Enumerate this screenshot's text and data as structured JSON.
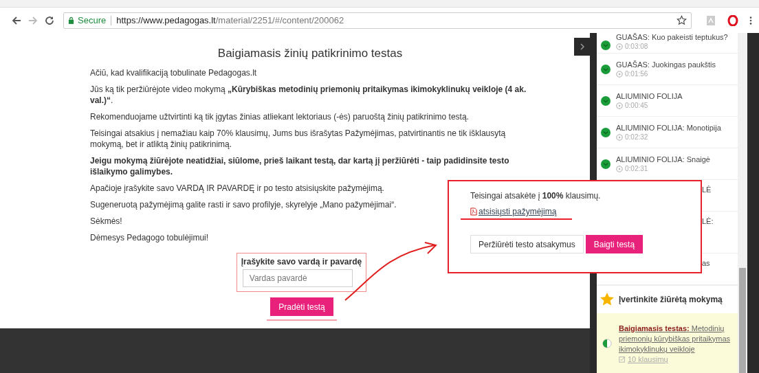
{
  "browser": {
    "secure_label": "Secure",
    "url_host": "https://www.pedagogas.lt",
    "url_path": "/material/2251/#/content/200062"
  },
  "content": {
    "title": "Baigiamasis žinių patikrinimo testas",
    "paragraphs": [
      {
        "text": "Ačiū, kad kvalifikaciją tobulinate Pedagogas.lt",
        "bold": false
      },
      {
        "text": "Jūs ką tik peržiūrėjote video mokymą **„Kūrybiškas metodinių priemonių pritaikymas ikimokyklinukų veikloje (4 ak. val.)“**.",
        "bold": false
      },
      {
        "text": "Rekomenduojame užtvirtinti ką tik įgytas žinias atliekant lektoriaus (-ės) paruoštą žinių patikrinimo testą.",
        "bold": false
      },
      {
        "text": "Teisingai atsakius į nemažiau kaip 70% klausimų, Jums bus išrašytas Pažymėjimas, patvirtinantis ne tik išklausytą mokymą, bet ir atliktą žinių patikrinimą.",
        "bold": false
      },
      {
        "text": "Jeigu mokymą žiūrėjote neatidžiai, siūlome, prieš laikant testą, dar kartą jį peržiūrėti - taip padidinsite testo išlaikymo galimybes.",
        "bold": true
      },
      {
        "text": "Apačioje įrašykite savo VARDĄ IR PAVARDĘ ir po testo atsisiųskite pažymėjimą.",
        "bold": false
      },
      {
        "text": "Sugeneruotą pažymėjimą galite rasti ir savo profilyje, skyrelyje „Mano pažymėjimai“.",
        "bold": false
      },
      {
        "text": "Sėkmės!",
        "bold": false
      },
      {
        "text": "Dėmesys Pedagogo tobulėjimui!",
        "bold": false
      }
    ],
    "name_form": {
      "label": "Įrašykite savo vardą ir pavardę",
      "placeholder": "Vardas pavardė"
    },
    "start_button": "Pradėti testą"
  },
  "popup": {
    "result_text": "Teisingai atsakėte į **100%** klausimų.",
    "download_link": "atsisiųsti pažymėjimą",
    "buttons": [
      {
        "label": "Peržiūrėti testo atsakymus",
        "kind": "secondary"
      },
      {
        "label": "Baigti testą",
        "kind": "primary"
      }
    ]
  },
  "sidebar": {
    "items": [
      {
        "kind": "video",
        "title": "GUAŠAS: Kuo pakeisti teptukus?",
        "duration": "0:03:08"
      },
      {
        "kind": "video",
        "title": "GUAŠAS: Juokingas paukštis",
        "duration": "0:01:56"
      },
      {
        "kind": "video",
        "title": "ALIUMINIO FOLIJA",
        "duration": "0:00:45"
      },
      {
        "kind": "video",
        "title": "ALIUMINIO FOLIJA: Monotipija",
        "duration": "0:02:32"
      },
      {
        "kind": "video",
        "title": "ALIUMINIO FOLIJA: Snaigė",
        "duration": "0:02:31"
      },
      {
        "kind": "covered",
        "title": "LĖ"
      },
      {
        "kind": "covered",
        "title": "LĖ:"
      },
      {
        "kind": "covered",
        "title": "as"
      }
    ],
    "rating_label": "Įvertinkite žiūrėtą mokymą",
    "test_item": {
      "title": "**Baigiamasis testas:** Metodinių priemonių kūrybiškas pritaikymas ikimokyklinukų veikloje",
      "count": "10 klausimų"
    }
  }
}
